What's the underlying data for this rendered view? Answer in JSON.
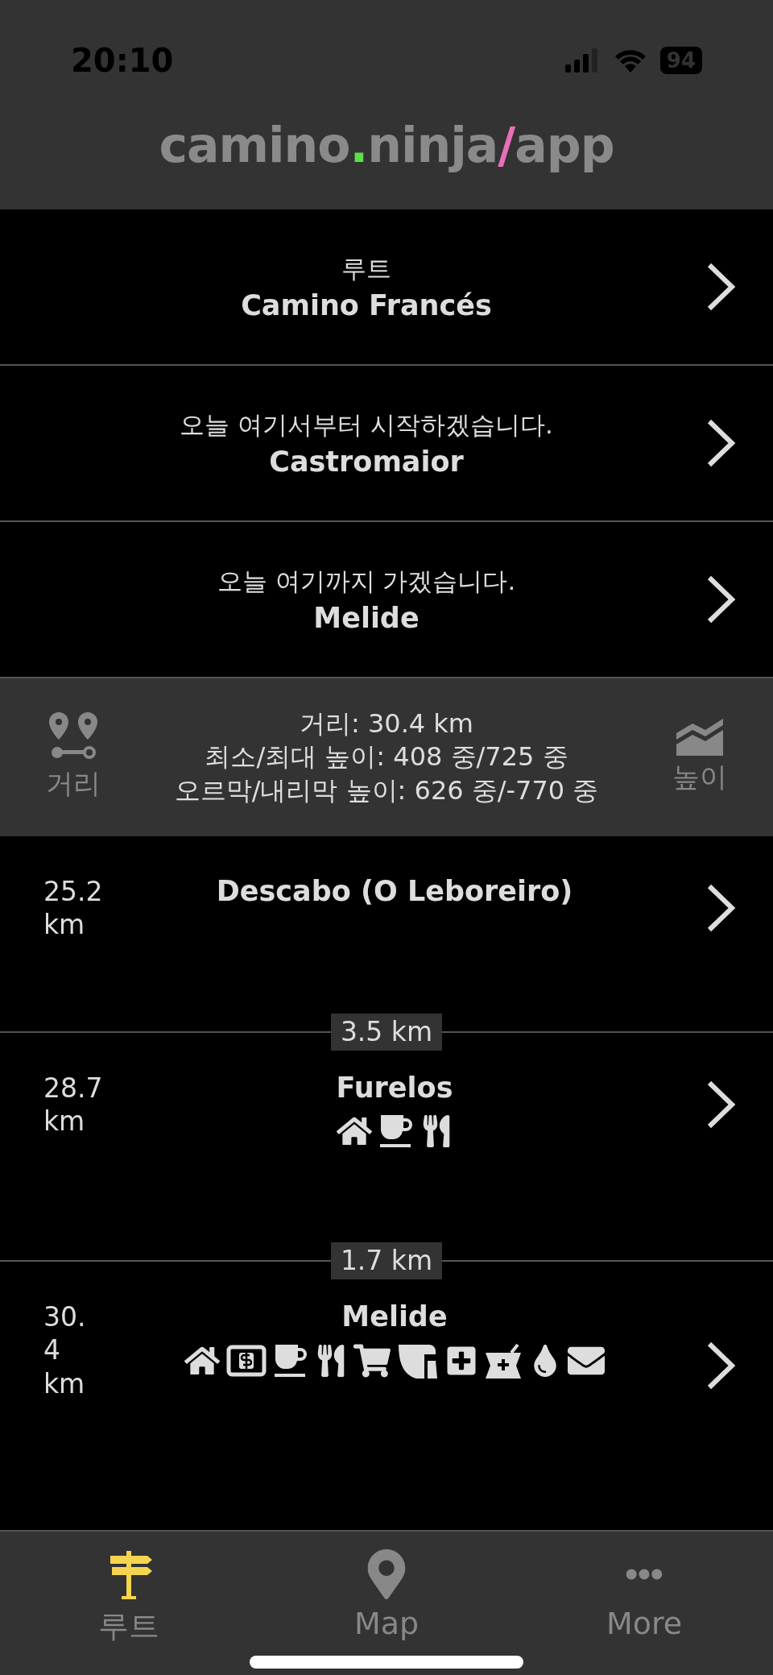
{
  "status_bar": {
    "time": "20:10",
    "battery": "94"
  },
  "logo": {
    "parts": [
      {
        "text": "camino",
        "color": "#8a8a8a"
      },
      {
        "text": ".",
        "color": "#5ce04a"
      },
      {
        "text": "ninja",
        "color": "#8a8a8a"
      },
      {
        "text": "/",
        "color": "#e86fb8"
      },
      {
        "text": "app",
        "color": "#8a8a8a"
      }
    ]
  },
  "selectors": [
    {
      "label": "루트",
      "value": "Camino Francés"
    },
    {
      "label": "오늘 여기서부터 시작하겠습니다.",
      "value": "Castromaior"
    },
    {
      "label": "오늘 여기까지 가겠습니다.",
      "value": "Melide"
    }
  ],
  "summary": {
    "left_label": "거리",
    "right_label": "높이",
    "lines": [
      "거리: 30.4 km",
      "최소/최대 높이: 408 중/725 중",
      "오르막/내리막 높이: 626 중/-770 중"
    ]
  },
  "stops": [
    {
      "distance_lines": [
        "25.2",
        "km"
      ],
      "name": "Descabo (O Leboreiro)"
    },
    {
      "gap": "3.5 km",
      "distance_lines": [
        "28.7",
        "km"
      ],
      "name": "Furelos",
      "amenities": [
        {
          "kind": "house"
        },
        {
          "kind": "cafe"
        },
        {
          "kind": "restaurant"
        }
      ]
    },
    {
      "gap": "1.7 km",
      "distance_lines": [
        "30.",
        "4",
        "km"
      ],
      "name": "Melide",
      "amenities": [
        {
          "kind": "house"
        },
        {
          "kind": "money"
        },
        {
          "kind": "cafe"
        },
        {
          "kind": "restaurant"
        },
        {
          "kind": "shop"
        },
        {
          "kind": "shoe"
        },
        {
          "kind": "medical"
        },
        {
          "kind": "pharmacy"
        },
        {
          "kind": "water"
        },
        {
          "kind": "post"
        }
      ]
    }
  ],
  "tabs": [
    {
      "label": "루트",
      "kind": "signpost",
      "selected": true
    },
    {
      "label": "Map",
      "kind": "map",
      "selected": false
    },
    {
      "label": "More",
      "kind": "more",
      "selected": false
    }
  ]
}
